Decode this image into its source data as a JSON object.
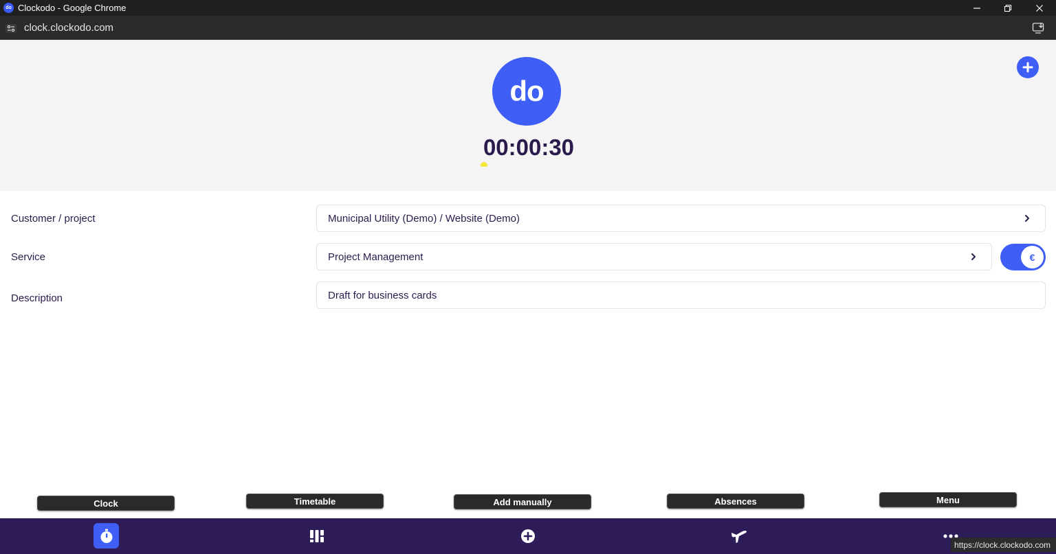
{
  "window": {
    "title": "Clockodo - Google Chrome",
    "favicon_text": "do"
  },
  "browser": {
    "url": "clock.clockodo.com"
  },
  "header": {
    "logo_text": "do",
    "timer": "00:00:30"
  },
  "form": {
    "customer_project": {
      "label": "Customer / project",
      "value": "Municipal Utility (Demo) / Website (Demo)"
    },
    "service": {
      "label": "Service",
      "value": "Project Management",
      "billable_toggle_symbol": "€",
      "billable_on": true
    },
    "description": {
      "label": "Description",
      "value": "Draft for business cards"
    }
  },
  "nav": {
    "items": [
      {
        "label": "Clock",
        "icon": "stopwatch-icon",
        "active": true
      },
      {
        "label": "Timetable",
        "icon": "timetable-icon",
        "active": false
      },
      {
        "label": "Add manually",
        "icon": "plus-circle-icon",
        "active": false
      },
      {
        "label": "Absences",
        "icon": "airplane-icon",
        "active": false
      },
      {
        "label": "Menu",
        "icon": "more-dots-icon",
        "active": false
      }
    ]
  },
  "status_bar": {
    "link_url": "https://clock.clockodo.com"
  },
  "colors": {
    "brand_blue": "#3f5ef5",
    "nav_background": "#2e1c58",
    "text_dark": "#2b1b4d"
  }
}
